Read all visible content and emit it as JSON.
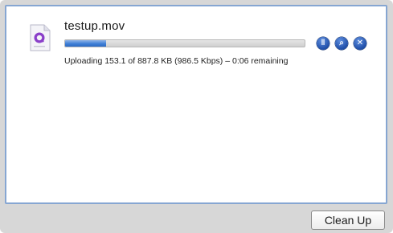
{
  "upload": {
    "file_name": "testup.mov",
    "progress_fraction": 0.17,
    "status": "Uploading 153.1 of 887.8 KB (986.5 Kbps) – 0:06 remaining"
  },
  "actions": [
    {
      "name": "pause-icon",
      "glyph": "‖"
    },
    {
      "name": "reveal-icon",
      "glyph": "⌕"
    },
    {
      "name": "cancel-icon",
      "glyph": "✕"
    }
  ],
  "footer": {
    "cleanup_label": "Clean Up"
  },
  "colors": {
    "accent": "#3f7fd6",
    "panel_border": "#86a6d2",
    "file_icon": "#8a3fc9"
  }
}
